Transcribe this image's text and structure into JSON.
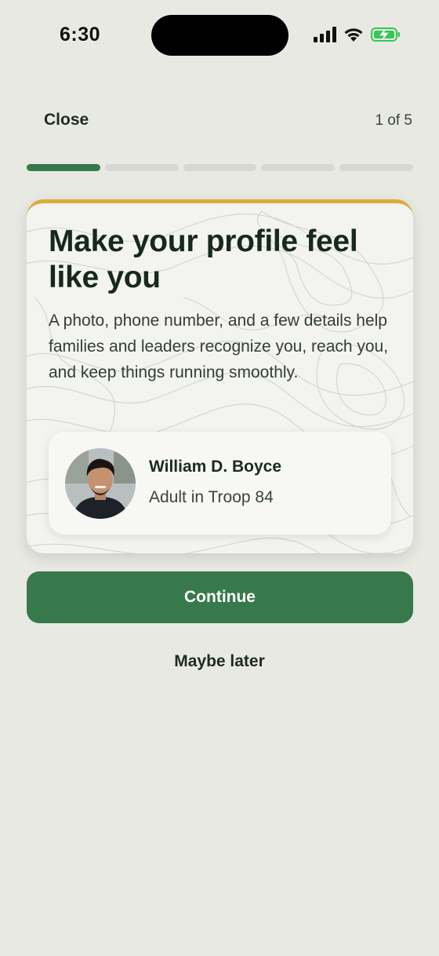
{
  "status_bar": {
    "time": "6:30",
    "icons": [
      "cellular-signal-icon",
      "wifi-icon",
      "battery-charging-icon"
    ],
    "battery_color": "#34c759"
  },
  "header": {
    "close_label": "Close",
    "step_text": "1 of 5"
  },
  "progress": {
    "total_steps": 5,
    "current_step": 1,
    "active_color": "#37794a",
    "inactive_color": "#d6d9d2"
  },
  "card": {
    "accent_color": "#d9ac3c",
    "title": "Make your profile feel like you",
    "description": "A photo, phone number, and a few details help families and leaders recognize you, reach you, and keep things running smoothly.",
    "profile": {
      "name": "William D. Boyce",
      "role": "Adult in Troop 84"
    }
  },
  "actions": {
    "continue_label": "Continue",
    "later_label": "Maybe later",
    "primary_color": "#37794a"
  }
}
